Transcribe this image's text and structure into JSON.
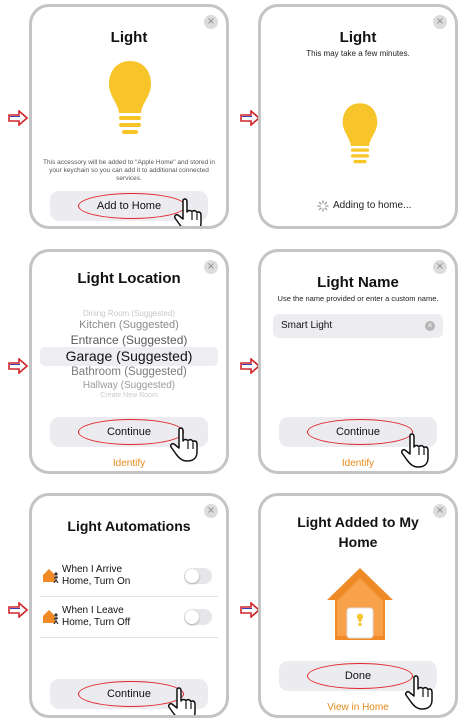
{
  "colors": {
    "accent_red": "#e0262b",
    "bulb": "#f7c52a",
    "link_orange": "#e68a1c",
    "house": "#f08a24",
    "card_border": "#c4c4c4"
  },
  "close_glyph": "×",
  "screen1": {
    "title": "Light",
    "info": "This accessory will be added to \"Apple Home\" and stored in your keychain so you can add it to additional connected services.",
    "button": "Add to Home"
  },
  "screen2": {
    "title": "Light",
    "subtitle": "This may take a few minutes.",
    "status": "Adding to home..."
  },
  "screen3": {
    "title": "Light Location",
    "picker": [
      "Dining Room (Suggested)",
      "Kitchen (Suggested)",
      "Entrance (Suggested)",
      "Garage (Suggested)",
      "Bathroom (Suggested)",
      "Hallway (Suggested)",
      "Create New Room"
    ],
    "selected_index": 3,
    "button": "Continue",
    "link": "Identify"
  },
  "screen4": {
    "title": "Light Name",
    "subtitle": "Use the name provided or enter a custom name.",
    "input_value": "Smart Light",
    "button": "Continue",
    "link": "Identify"
  },
  "screen5": {
    "title": "Light Automations",
    "rows": [
      {
        "label": "When I Arrive Home, Turn On",
        "on": false
      },
      {
        "label": "When I Leave Home, Turn Off",
        "on": false
      }
    ],
    "button": "Continue"
  },
  "screen6": {
    "title": "Light Added to My Home",
    "button": "Done",
    "link": "View in Home"
  }
}
